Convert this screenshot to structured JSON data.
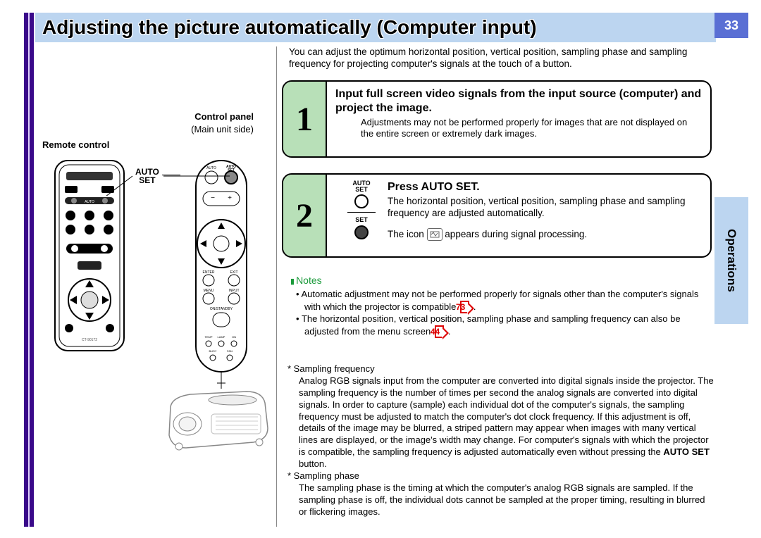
{
  "page_number": "33",
  "side_tab": "Operations",
  "title": "Adjusting the picture automatically (Computer input)",
  "intro": "You can adjust the optimum horizontal position, vertical position, sampling phase and sampling frequency for projecting computer's signals at the touch of a button.",
  "step1": {
    "num": "1",
    "heading": "Input full screen video signals from the input source (computer) and project the image.",
    "body": "Adjustments may not be performed properly for images that are not displayed on the entire screen or extremely dark images."
  },
  "step2": {
    "num": "2",
    "icon_top_label": "AUTO SET",
    "icon_bottom_label": "SET",
    "heading": "Press AUTO SET.",
    "body1": "The horizontal position, vertical position, sampling phase and sampling frequency are adjusted automatically.",
    "body2a": "The icon ",
    "body2b": " appears during signal processing."
  },
  "notes_label": "Notes",
  "bullets": [
    {
      "text_a": "Automatic adjustment may not be performed properly for signals other than the computer's signals with which the projector is compatible ",
      "ref": "73",
      "text_b": "."
    },
    {
      "text_a": "The horizontal position, vertical position, sampling phase and sampling frequency can also be adjusted from the menu screen ",
      "ref": "44",
      "text_b": "."
    }
  ],
  "defs": [
    {
      "term": "Sampling frequency",
      "body": "Analog RGB signals input from the computer are converted into digital signals inside the projector. The sampling frequency is the number of times per second the analog signals are converted into digital signals. In order to capture (sample) each individual dot of the computer's signals, the sampling frequency must be adjusted to match the computer's dot clock frequency. If this adjustment is off, details of the image may be blurred, a striped pattern may appear when images with many vertical lines are displayed, or the image's width may change. For computer's signals with which the projector is compatible, the sampling frequency is adjusted automatically even without pressing the ",
      "bold": "AUTO SET",
      "body2": " button."
    },
    {
      "term": "Sampling phase",
      "body": "The sampling phase is the timing at which the computer's analog RGB signals are sampled. If the sampling phase is off, the individual dots cannot be sampled at the proper timing, resulting in blurred or flickering images."
    }
  ],
  "left": {
    "control_panel": "Control panel",
    "main_unit": "(Main unit side)",
    "remote": "Remote control",
    "autoset": "AUTO SET"
  }
}
